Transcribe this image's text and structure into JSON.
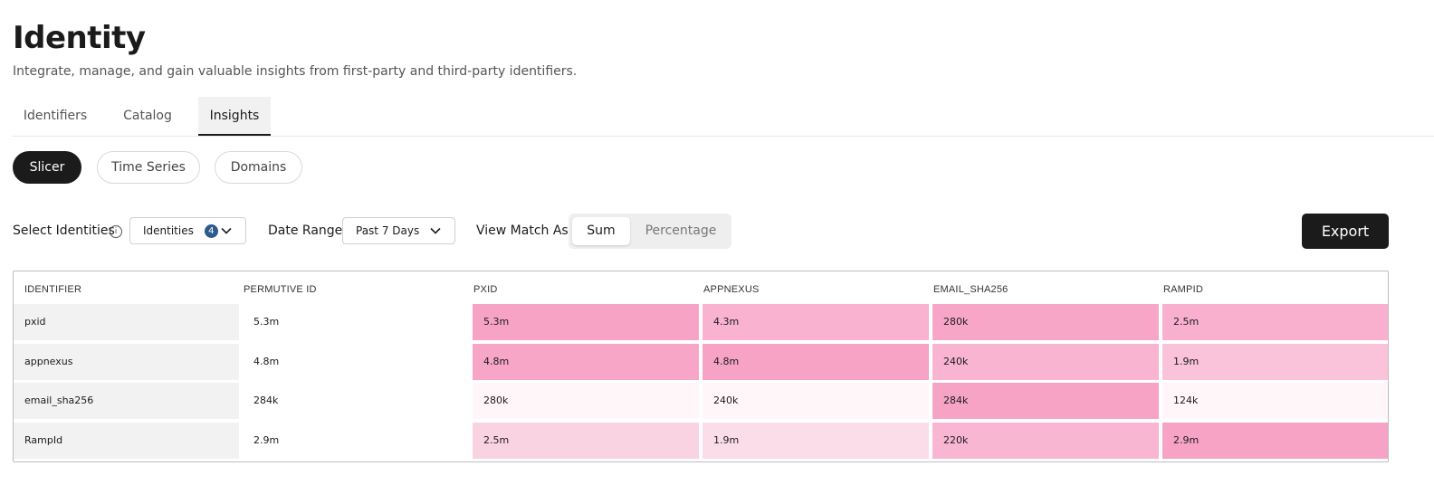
{
  "page": {
    "title": "Identity",
    "subtitle": "Integrate, manage, and gain valuable insights from first-party and third-party identifiers."
  },
  "tabs": [
    {
      "label": "Identifiers",
      "active": false
    },
    {
      "label": "Catalog",
      "active": false
    },
    {
      "label": "Insights",
      "active": true
    }
  ],
  "views": [
    {
      "label": "Slicer",
      "active": true
    },
    {
      "label": "Time Series",
      "active": false
    },
    {
      "label": "Domains",
      "active": false
    }
  ],
  "controls": {
    "select_identities_label": "Select Identities",
    "identities_dropdown": {
      "value": "Identities",
      "badge": "4"
    },
    "date_range_label": "Date Range:",
    "date_range_dropdown": {
      "value": "Past 7 Days"
    },
    "view_match_label": "View Match As:",
    "view_match_options": [
      {
        "label": "Sum",
        "active": true
      },
      {
        "label": "Percentage",
        "active": false
      }
    ],
    "export_label": "Export"
  },
  "table": {
    "columns": [
      "IDENTIFIER",
      "PERMUTIVE ID",
      "PXID",
      "APPNEXUS",
      "EMAIL_SHA256",
      "RAMPID"
    ],
    "rows": [
      {
        "identifier": "pxid",
        "values": [
          "5.3m",
          "5.3m",
          "4.3m",
          "280k",
          "2.5m"
        ],
        "colors": [
          "#ffffff",
          "#f7a3c6",
          "#f9b2d0",
          "#f8a6c8",
          "#f9b0ce"
        ]
      },
      {
        "identifier": "appnexus",
        "values": [
          "4.8m",
          "4.8m",
          "4.8m",
          "240k",
          "1.9m"
        ],
        "colors": [
          "#ffffff",
          "#f7a6c8",
          "#f7a3c6",
          "#f9b4d1",
          "#fac3da"
        ]
      },
      {
        "identifier": "email_sha256",
        "values": [
          "284k",
          "280k",
          "240k",
          "284k",
          "124k"
        ],
        "colors": [
          "#ffffff",
          "#fff6f9",
          "#fff6f9",
          "#f7a3c6",
          "#fff6f9"
        ]
      },
      {
        "identifier": "RampId",
        "values": [
          "2.9m",
          "2.5m",
          "1.9m",
          "220k",
          "2.9m"
        ],
        "colors": [
          "#ffffff",
          "#fad3e3",
          "#fbdde9",
          "#f9b6d2",
          "#f7a3c6"
        ]
      }
    ],
    "identifier_cell_color": "#f2f2f2"
  },
  "colors": {
    "accent_dark": "#1b1b1b",
    "badge": "#2c5a8c"
  },
  "icons": {
    "info": "info-icon",
    "chevron": "chevron-down-icon"
  }
}
